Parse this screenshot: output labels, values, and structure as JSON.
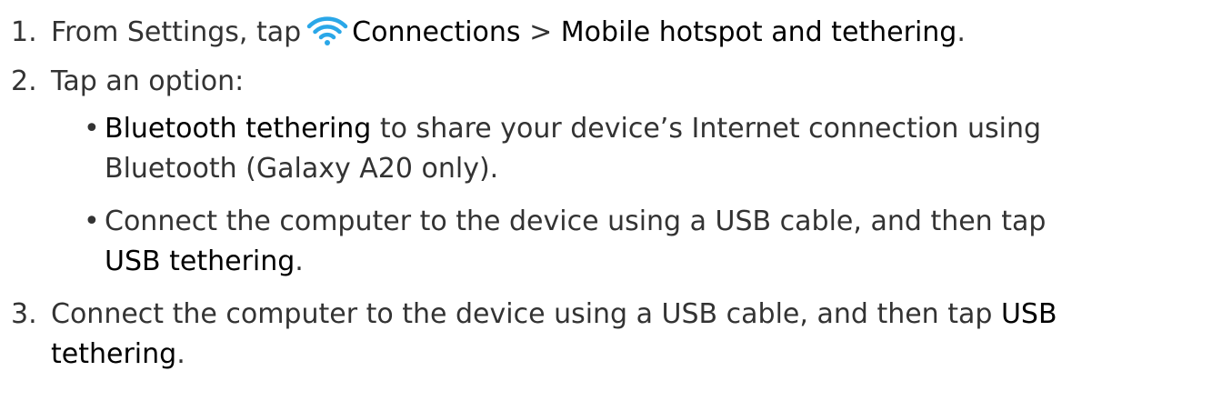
{
  "steps": [
    {
      "number": "1.",
      "prefix": "From Settings, tap",
      "icon": "wifi-icon",
      "icon_color": "#2aa7e8",
      "menu1": "Connections",
      "separator": ">",
      "menu2": "Mobile hotspot and tethering",
      "end": "."
    },
    {
      "number": "2.",
      "text": "Tap an option:",
      "bullets": [
        {
          "bullet": "•",
          "ui": "Bluetooth tethering",
          "text_line1": "to share your device’s Internet connection using",
          "text_line2": "Bluetooth (Galaxy A20 only)."
        },
        {
          "bullet": "•",
          "text_line1": "Connect the computer to the device using a USB cable, and then tap",
          "ui": "USB tethering",
          "end": "."
        }
      ]
    },
    {
      "number": "3.",
      "text_line1": "Connect the computer to the device using a USB cable, and then tap",
      "ui_part1": "USB",
      "ui_part2": "tethering",
      "end": "."
    }
  ]
}
